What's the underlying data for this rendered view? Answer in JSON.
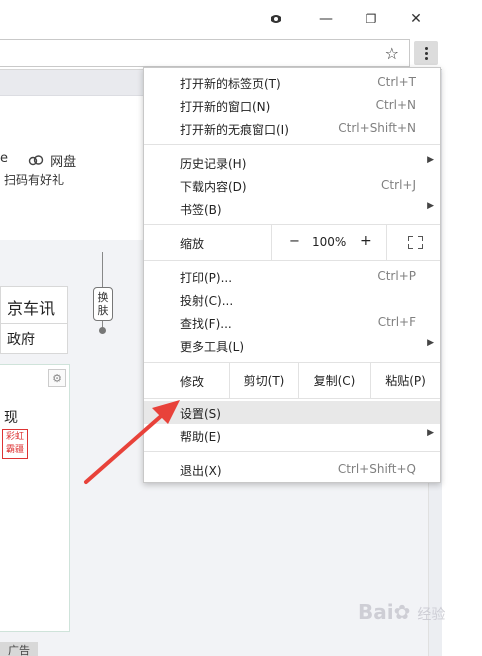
{
  "window": {
    "controls": {
      "minimize": "—",
      "maximize": "❐",
      "close": "✕"
    },
    "icons": {
      "profile": "profile-icon",
      "bookmark": "star-icon",
      "menu": "kebab-menu-icon"
    }
  },
  "page": {
    "frag_e": "e",
    "netdisk": "网盘",
    "scan_gift": "扫码有好礼",
    "news_box": "京车讯",
    "gov_box": "政府",
    "skin_tag": "换肤",
    "frag_xian": "现",
    "stamp_text": "彩虹霸疆",
    "ad_label": "广告"
  },
  "menu": {
    "group1": [
      {
        "label": "打开新的标签页(T)",
        "shortcut": "Ctrl+T"
      },
      {
        "label": "打开新的窗口(N)",
        "shortcut": "Ctrl+N"
      },
      {
        "label": "打开新的无痕窗口(I)",
        "shortcut": "Ctrl+Shift+N"
      }
    ],
    "group2": [
      {
        "label": "历史记录(H)",
        "shortcut": "",
        "submenu": true
      },
      {
        "label": "下载内容(D)",
        "shortcut": "Ctrl+J"
      },
      {
        "label": "书签(B)",
        "shortcut": "",
        "submenu": true
      }
    ],
    "zoom": {
      "label": "缩放",
      "minus": "−",
      "value": "100%",
      "plus": "+"
    },
    "group3": [
      {
        "label": "打印(P)...",
        "shortcut": "Ctrl+P"
      },
      {
        "label": "投射(C)...",
        "shortcut": ""
      },
      {
        "label": "查找(F)...",
        "shortcut": "Ctrl+F"
      },
      {
        "label": "更多工具(L)",
        "shortcut": "",
        "submenu": true
      }
    ],
    "edit": {
      "label": "修改",
      "cut": "剪切(T)",
      "copy": "复制(C)",
      "paste": "粘贴(P)"
    },
    "group4": [
      {
        "label": "设置(S)",
        "shortcut": "",
        "highlighted": true
      },
      {
        "label": "帮助(E)",
        "shortcut": "",
        "submenu": true
      }
    ],
    "exit": {
      "label": "退出(X)",
      "shortcut": "Ctrl+Shift+Q"
    }
  },
  "annotation": {
    "arrow_color": "#e8423a"
  },
  "watermark": {
    "main": "Bai",
    "sub": "经验"
  }
}
